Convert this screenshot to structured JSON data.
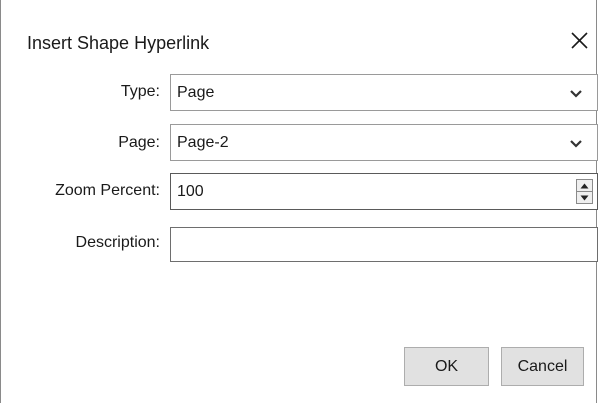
{
  "dialog": {
    "title": "Insert Shape Hyperlink"
  },
  "icons": {
    "close": "close-icon",
    "dropdown": "chevron-down-icon",
    "spin_up": "triangle-up-icon",
    "spin_down": "triangle-down-icon"
  },
  "fields": {
    "type": {
      "label": "Type:",
      "value": "Page"
    },
    "page": {
      "label": "Page:",
      "value": "Page-2"
    },
    "zoom": {
      "label": "Zoom Percent:",
      "value": "100"
    },
    "description": {
      "label": "Description:",
      "value": ""
    }
  },
  "buttons": {
    "ok": "OK",
    "cancel": "Cancel"
  },
  "colors": {
    "button_face": "#e1e1e1",
    "border": "#9a9a9a"
  }
}
